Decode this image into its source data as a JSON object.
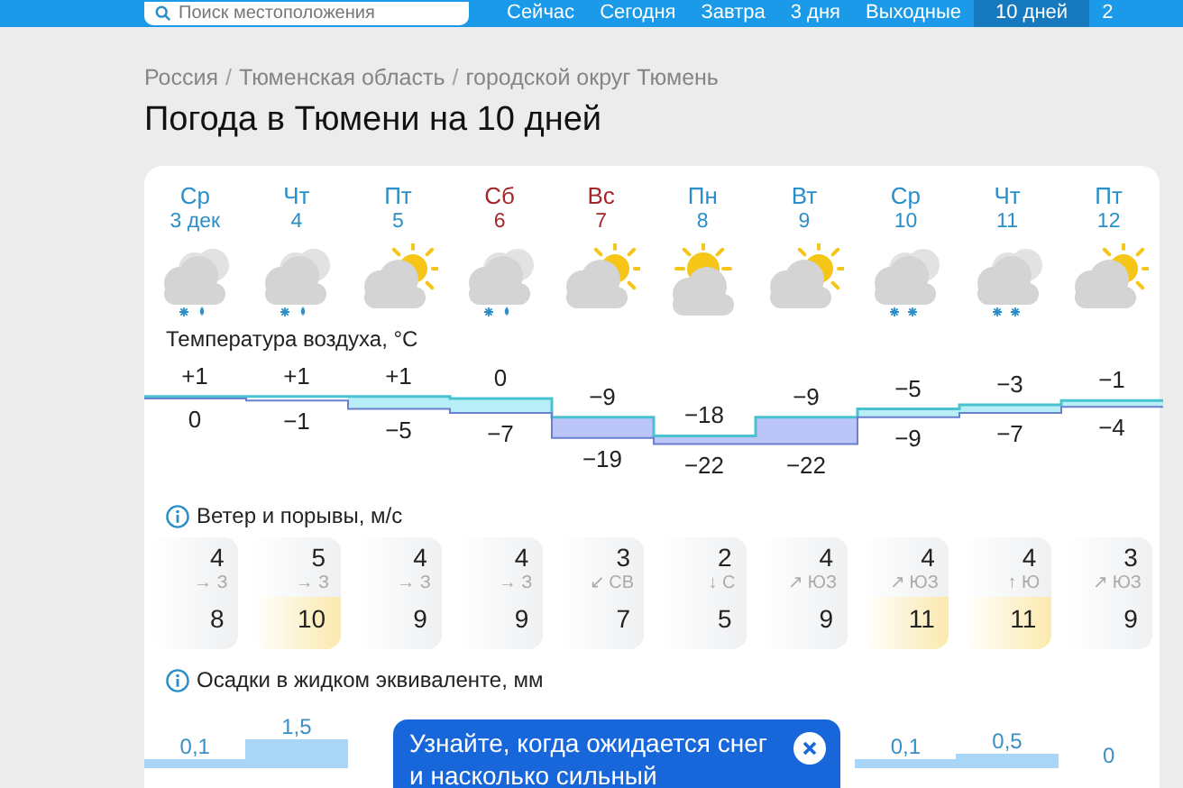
{
  "nav": {
    "search": {
      "placeholder": "Поиск местоположения"
    },
    "tabs": [
      {
        "label": "Сейчас",
        "selected": false
      },
      {
        "label": "Сегодня",
        "selected": false
      },
      {
        "label": "Завтра",
        "selected": false
      },
      {
        "label": "3 дня",
        "selected": false
      },
      {
        "label": "Выходные",
        "selected": false
      },
      {
        "label": "10 дней",
        "selected": true
      },
      {
        "label": "2",
        "selected": false
      }
    ]
  },
  "breadcrumb": [
    {
      "kind": "link",
      "text": "Россия"
    },
    {
      "kind": "separator",
      "text": "/"
    },
    {
      "kind": "link",
      "text": "Тюменская область"
    },
    {
      "kind": "separator",
      "text": "/"
    },
    {
      "kind": "link",
      "text": "городской округ Тюмень"
    }
  ],
  "title": "Погода в Тюмени на 10 дней",
  "days": [
    {
      "weekday": "Ср",
      "date": "3 дек",
      "weekend": false,
      "kind": "cloudy-sleet",
      "high": "+1",
      "low": "0"
    },
    {
      "weekday": "Чт",
      "date": "4",
      "weekend": false,
      "kind": "cloudy-sleet",
      "high": "+1",
      "low": "−1"
    },
    {
      "weekday": "Пт",
      "date": "5",
      "weekend": false,
      "kind": "partly-sunny",
      "high": "+1",
      "low": "−5"
    },
    {
      "weekday": "Сб",
      "date": "6",
      "weekend": true,
      "kind": "cloudy-sleet",
      "high": "0",
      "low": "−7"
    },
    {
      "weekday": "Вс",
      "date": "7",
      "weekend": true,
      "kind": "partly-sunny",
      "high": "−9",
      "low": "−19"
    },
    {
      "weekday": "Пн",
      "date": "8",
      "weekend": false,
      "kind": "sunny",
      "high": "−18",
      "low": "−22"
    },
    {
      "weekday": "Вт",
      "date": "9",
      "weekend": false,
      "kind": "partly-sunny",
      "high": "−9",
      "low": "−22"
    },
    {
      "weekday": "Ср",
      "date": "10",
      "weekend": false,
      "kind": "cloudy-snow",
      "high": "−5",
      "low": "−9"
    },
    {
      "weekday": "Чт",
      "date": "11",
      "weekend": false,
      "kind": "cloudy-snow",
      "high": "−3",
      "low": "−7"
    },
    {
      "weekday": "Пт",
      "date": "12",
      "weekend": false,
      "kind": "partly-sunny",
      "high": "−1",
      "low": "−4"
    }
  ],
  "temperature_title": "Температура воздуха, °C",
  "wind_title": "Ветер и порывы, м/с",
  "wind": [
    {
      "speed": "4",
      "direction": "→ З",
      "gust": "8",
      "strong": false
    },
    {
      "speed": "5",
      "direction": "→ З",
      "gust": "10",
      "strong": true
    },
    {
      "speed": "4",
      "direction": "→ З",
      "gust": "9",
      "strong": false
    },
    {
      "speed": "4",
      "direction": "→ З",
      "gust": "9",
      "strong": false
    },
    {
      "speed": "3",
      "direction": "↙ СВ",
      "gust": "7",
      "strong": false
    },
    {
      "speed": "2",
      "direction": "↓ С",
      "gust": "5",
      "strong": false
    },
    {
      "speed": "4",
      "direction": "↗ ЮЗ",
      "gust": "9",
      "strong": false
    },
    {
      "speed": "4",
      "direction": "↗ ЮЗ",
      "gust": "11",
      "strong": true
    },
    {
      "speed": "4",
      "direction": "↑ Ю",
      "gust": "11",
      "strong": true
    },
    {
      "speed": "3",
      "direction": "↗ ЮЗ",
      "gust": "9",
      "strong": false
    }
  ],
  "precipitation_title": "Осадки в жидком эквиваленте, мм",
  "precipitation": [
    {
      "kind": "bar",
      "amount": "0,1"
    },
    {
      "kind": "bar",
      "amount": "1,5"
    },
    {
      "kind": "covered"
    },
    {
      "kind": "covered"
    },
    {
      "kind": "covered"
    },
    {
      "kind": "covered"
    },
    {
      "kind": "covered"
    },
    {
      "kind": "bar",
      "amount": "0,1"
    },
    {
      "kind": "bar",
      "amount": "0,5"
    },
    {
      "kind": "bar",
      "amount": "0"
    }
  ],
  "popup": {
    "text": "Узнайте, когда ожидается снег и насколько сильный"
  }
}
